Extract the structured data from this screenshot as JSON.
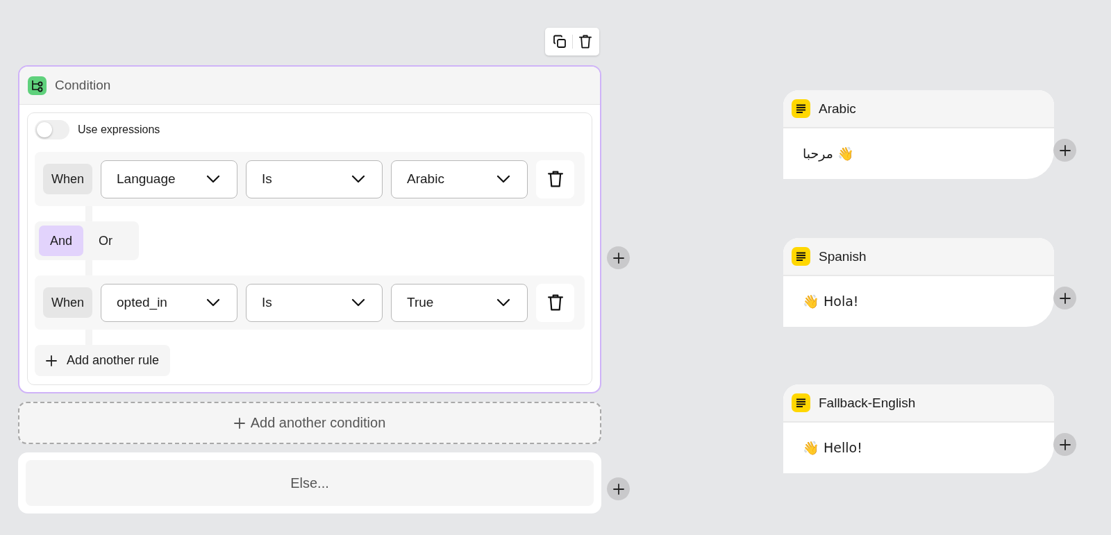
{
  "condition": {
    "title": "Condition",
    "use_expressions": {
      "label": "Use expressions",
      "on": false
    },
    "rules": [
      {
        "label": "When",
        "field": "Language",
        "operator": "Is",
        "value": "Arabic"
      },
      {
        "label": "When",
        "field": "opted_in",
        "operator": "Is",
        "value": "True"
      }
    ],
    "joiners": [
      {
        "label": "And",
        "selected": true
      },
      {
        "label": "Or",
        "selected": false
      }
    ],
    "add_rule": "Add another rule"
  },
  "add_condition": "Add another condition",
  "else_label": "Else...",
  "messages": [
    {
      "title": "Arabic",
      "text": "مرحبا 👋"
    },
    {
      "title": "Spanish",
      "text": "👋 Hola!"
    },
    {
      "title": "Fallback-English",
      "text": "👋 Hello!"
    }
  ]
}
